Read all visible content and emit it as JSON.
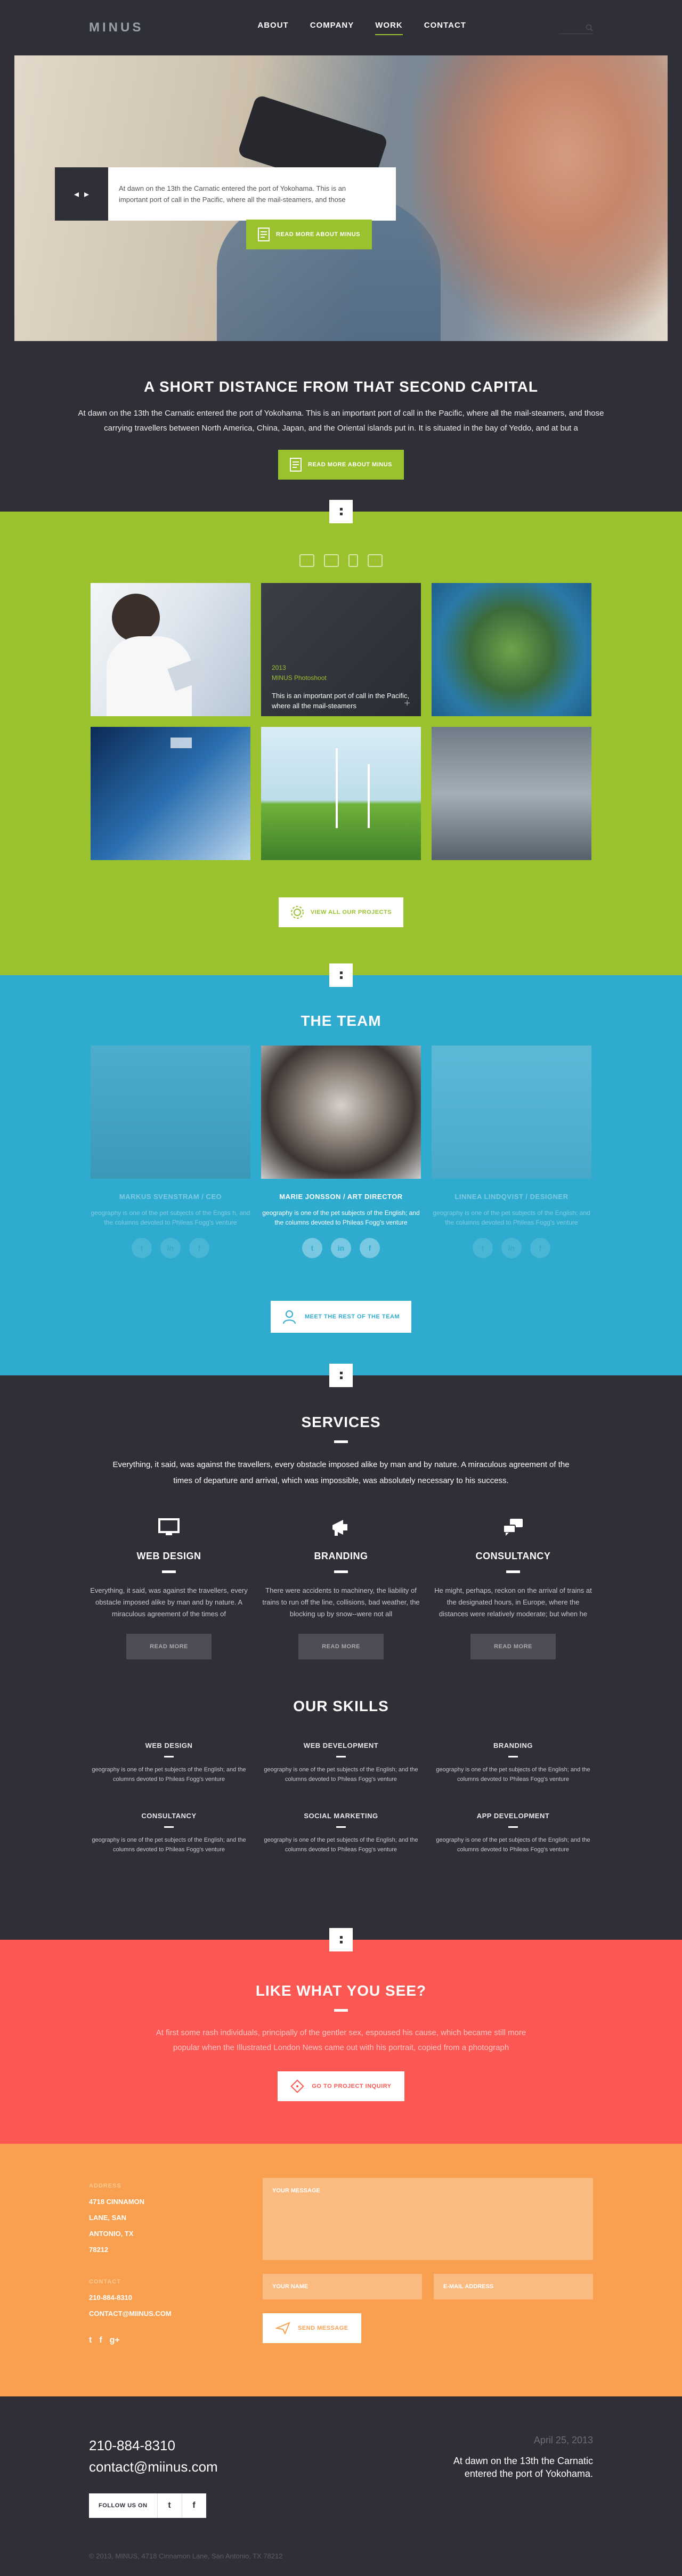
{
  "header": {
    "logo": "MINUS",
    "nav": [
      "ABOUT",
      "COMPANY",
      "WORK",
      "CONTACT"
    ],
    "active_nav": "WORK"
  },
  "hero": {
    "card_text": "At dawn on the 13th the Carnatic entered the port of Yokohama.  This is an important port of call in the Pacific, where all the mail-steamers, and those",
    "cta": "READ MORE ABOUT MINUS"
  },
  "intro": {
    "title": "A SHORT DISTANCE FROM THAT SECOND CAPITAL",
    "text": "At dawn on the 13th the Carnatic entered the port of Yokohama.  This is an important port of call in the Pacific, where all the mail-steamers, and those carrying travellers between North America, China, Japan, and the Oriental islands put in.  It is situated in the bay of Yeddo, and at but a",
    "cta": "READ MORE ABOUT MINUS"
  },
  "portfolio": {
    "featured": {
      "year": "2013",
      "title": "MINUS Photoshoot",
      "text": "This is an important port of call in the Pacific, where all the mail-steamers"
    },
    "cta": "VIEW ALL OUR PROJECTS"
  },
  "team": {
    "title": "THE TEAM",
    "members": [
      {
        "name": "MARKUS SVENSTRAM / CEO",
        "bio": "geography is one of the pet subjects of the Englis h, and the columns devoted to Phileas Fogg's venture"
      },
      {
        "name": "MARIE JONSSON / ART DIRECTOR",
        "bio": "geography is one of the pet subjects of the English; and the columns devoted to Phileas Fogg's venture"
      },
      {
        "name": "LINNEA LINDQVIST / DESIGNER",
        "bio": "geography is one of the pet subjects of the English; and the columns devoted to Phileas Fogg's venture"
      }
    ],
    "cta": "MEET THE REST OF THE TEAM"
  },
  "services": {
    "title": "SERVICES",
    "lead": "Everything, it said, was against the travellers, every obstacle imposed alike by man and by nature. A miraculous agreement of the times of departure and arrival, which was impossible, was absolutely necessary to his success.",
    "items": [
      {
        "title": "WEB DESIGN",
        "text": "Everything, it said, was against the travellers, every obstacle imposed alike by man and by nature. A miraculous agreement of the times of",
        "cta": "READ MORE"
      },
      {
        "title": "BRANDING",
        "text": "There were accidents to machinery, the liability of trains to run off the line, collisions, bad weather, the blocking up by snow--were not all",
        "cta": "READ MORE"
      },
      {
        "title": "CONSULTANCY",
        "text": "He might, perhaps, reckon on the arrival of trains at the designated hours, in Europe, where the distances were relatively moderate; but when he",
        "cta": "READ MORE"
      }
    ]
  },
  "skills": {
    "title": "OUR SKILLS",
    "items": [
      {
        "title": "WEB DESIGN",
        "text": "geography is one of the pet subjects of the English; and the columns devoted to Phileas Fogg's venture"
      },
      {
        "title": "WEB DEVELOPMENT",
        "text": "geography is one of the pet subjects of the English; and the columns devoted to Phileas Fogg's venture"
      },
      {
        "title": "BRANDING",
        "text": "geography is one of the pet subjects of the English; and the columns devoted to Phileas Fogg's venture"
      },
      {
        "title": "CONSULTANCY",
        "text": "geography is one of the pet subjects of the English; and the columns devoted to Phileas Fogg's venture"
      },
      {
        "title": "SOCIAL MARKETING",
        "text": "geography is one of the pet subjects of the English; and the columns devoted to Phileas Fogg's venture"
      },
      {
        "title": "APP DEVELOPMENT",
        "text": "geography is one of the pet subjects of the English; and the columns devoted to Phileas Fogg's venture"
      }
    ]
  },
  "like": {
    "title": "LIKE WHAT YOU SEE?",
    "text": "At first some rash individuals, principally of the gentler sex, espoused his cause, which became still more popular when the Illustrated London News came out with his portrait, copied from a photograph",
    "cta": "GO TO PROJECT INQUIRY"
  },
  "contact": {
    "address_label": "ADDRESS",
    "address_lines": [
      "4718 CINNAMON",
      "LANE, SAN",
      "ANTONIO, TX",
      "78212"
    ],
    "contact_label": "CONTACT",
    "phone": "210-884-8310",
    "email": "CONTACT@MIINUS.COM",
    "message_placeholder": "YOUR MESSAGE",
    "name_placeholder": "YOUR NAME",
    "email_placeholder": "E-MAIL ADDRESS",
    "send": "SEND MESSAGE"
  },
  "footer": {
    "phone": "210-884-8310",
    "email": "contact@miinus.com",
    "follow": "FOLLOW US ON",
    "date": "April 25, 2013",
    "quote": "At dawn on the 13th the Carnatic entered the port of Yokohama.",
    "copyright": "© 2013, MINUS, 4718 Cinnamon Lane, San Antonio, TX 78212"
  },
  "colors": {
    "dark": "#2f2f38",
    "green": "#9ac22e",
    "blue": "#2fabd0",
    "red": "#fb5753",
    "orange": "#f8a050"
  }
}
